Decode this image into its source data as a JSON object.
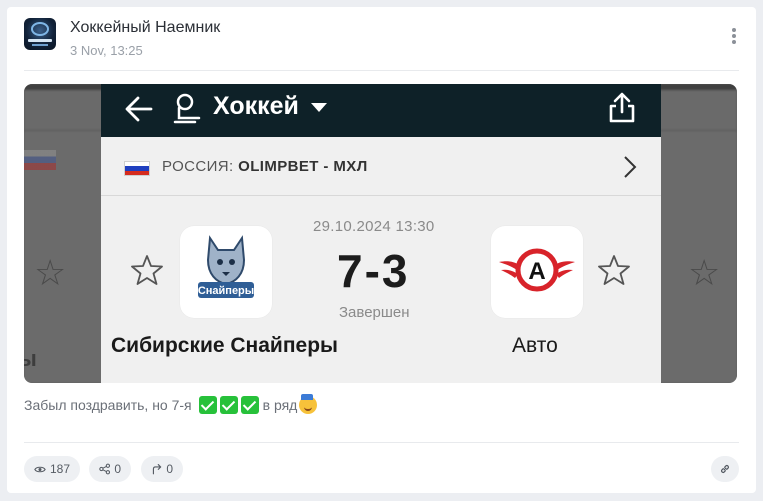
{
  "post": {
    "author": "Хоккейный Наемник",
    "time": "3 Nov, 13:25",
    "caption_text": "Забыл поздравить, но 7-я",
    "caption_tail": "в ряд"
  },
  "screenshot": {
    "sport_title": "Хоккей",
    "league_country": "РОССИЯ:",
    "league_name": "OLIMPBET - МХЛ",
    "datetime": "29.10.2024 13:30",
    "score": "7-3",
    "status": "Завершен",
    "home_team": "Сибирские Снайперы",
    "away_team": "Авто",
    "home_logo_text": "Снайперы",
    "away_logo_text": "А"
  },
  "stats": {
    "views": "187",
    "shares": "0",
    "reposts": "0"
  },
  "colors": {
    "topbar": "#0e2128",
    "check": "#27c13a",
    "avto_red": "#d8232a"
  },
  "icons": {
    "views": "eye-icon",
    "shares": "share-nodes-icon",
    "reposts": "repost-arrow-icon",
    "link": "link-icon",
    "more": "more-vertical-icon"
  }
}
